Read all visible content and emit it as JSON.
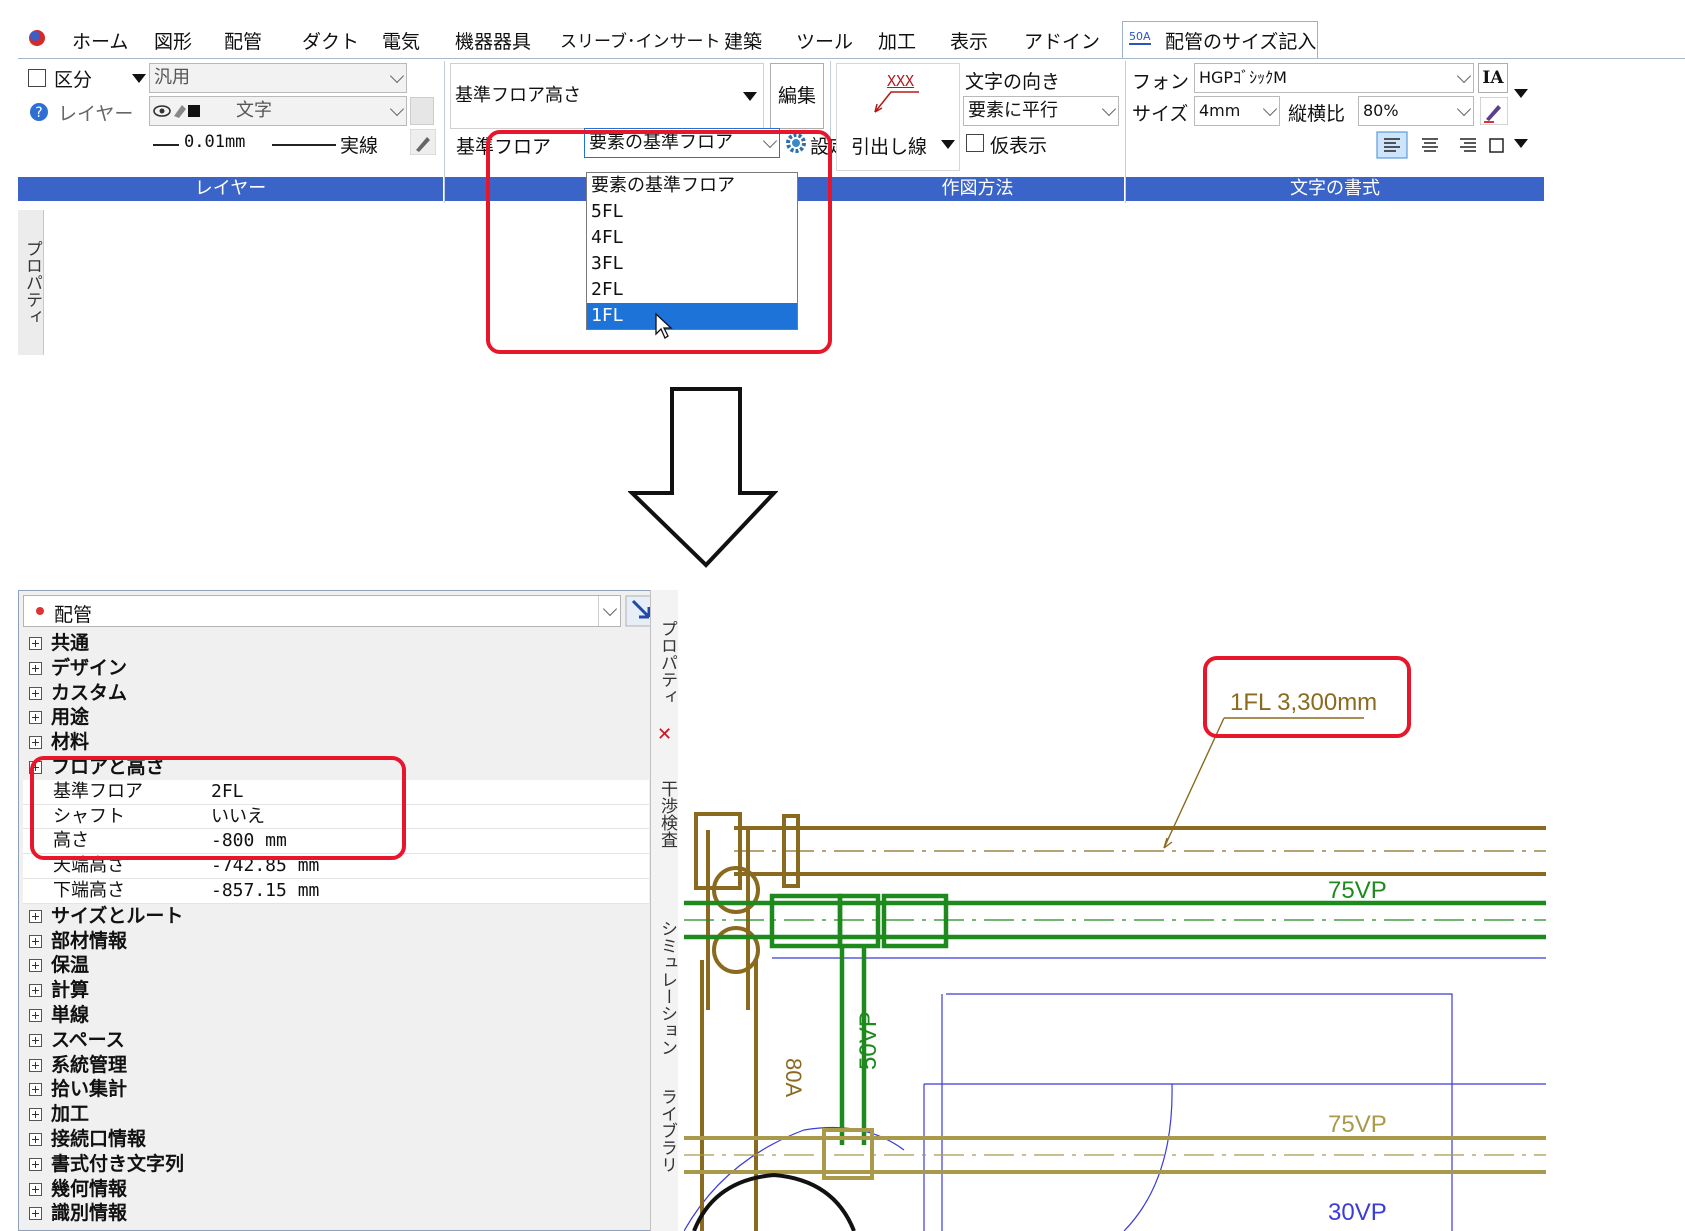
{
  "menu": [
    "ホーム",
    "図形",
    "配管",
    "ダクト",
    "電気",
    "機器器具",
    "スリーブ･インサート",
    "建築",
    "ツール",
    "加工",
    "表示",
    "アドイン"
  ],
  "active_tab": {
    "badge": "50A",
    "label": "配管のサイズ記入"
  },
  "layer_group": {
    "category_label": "区分",
    "category_value": "汎用",
    "layer_label": "レイヤー",
    "layer_value": "文字",
    "line_width": "0.01mm",
    "line_type": "実線",
    "title": "レイヤー"
  },
  "floor_group": {
    "height_mode": "基準フロア高さ",
    "edit_button": "編集",
    "base_floor_label": "基準フロア",
    "base_floor_value": "要素の基準フロア",
    "settings_button": "設定",
    "dropdown_options": [
      "要素の基準フロア",
      "5FL",
      "4FL",
      "3FL",
      "2FL",
      "1FL"
    ],
    "dropdown_selected": "1FL"
  },
  "draw_group": {
    "leader_sample": "XXX",
    "leader_label": "引出し線",
    "text_direction_label": "文字の向き",
    "text_direction_value": "要素に平行",
    "preview_label": "仮表示",
    "title": "作図方法"
  },
  "format_group": {
    "font_label": "フォント",
    "font_value": "HGPｺﾞｼｯｸM",
    "size_label": "サイズ",
    "size_value": "4mm",
    "ratio_label": "縦横比",
    "ratio_value": "80%",
    "title": "文字の書式"
  },
  "side_tabs": {
    "property": "プロパティ",
    "clash": "干渉検査",
    "simulation": "シミュレーション",
    "library": "ライブラリ"
  },
  "property_panel": {
    "element": "配管",
    "groups_before": [
      "共通",
      "デザイン",
      "カスタム",
      "用途",
      "材料"
    ],
    "open_group": "フロアと高さ",
    "rows": [
      {
        "key": "基準フロア",
        "value": "2FL"
      },
      {
        "key": "シャフト",
        "value": "いいえ"
      },
      {
        "key": "高さ",
        "value": "-800 mm"
      },
      {
        "key": "天端高さ",
        "value": "-742.85 mm"
      },
      {
        "key": "下端高さ",
        "value": "-857.15 mm"
      }
    ],
    "groups_after": [
      "サイズとルート",
      "部材情報",
      "保温",
      "計算",
      "単線",
      "スペース",
      "系統管理",
      "拾い集計",
      "加工",
      "接続口情報",
      "書式付き文字列",
      "幾何情報",
      "識別情報"
    ]
  },
  "drawing": {
    "callout": "1FL 3,300mm",
    "labels": [
      "75VP",
      "50VP",
      "80A",
      "75VP",
      "30VP"
    ],
    "colors": {
      "brown_pipe": "#8a6a1e",
      "green_pipe": "#1e8a1e",
      "olive_pipe": "#a89a4a",
      "blue_line": "#3b3bd8",
      "highlight": "#e8162b"
    }
  }
}
